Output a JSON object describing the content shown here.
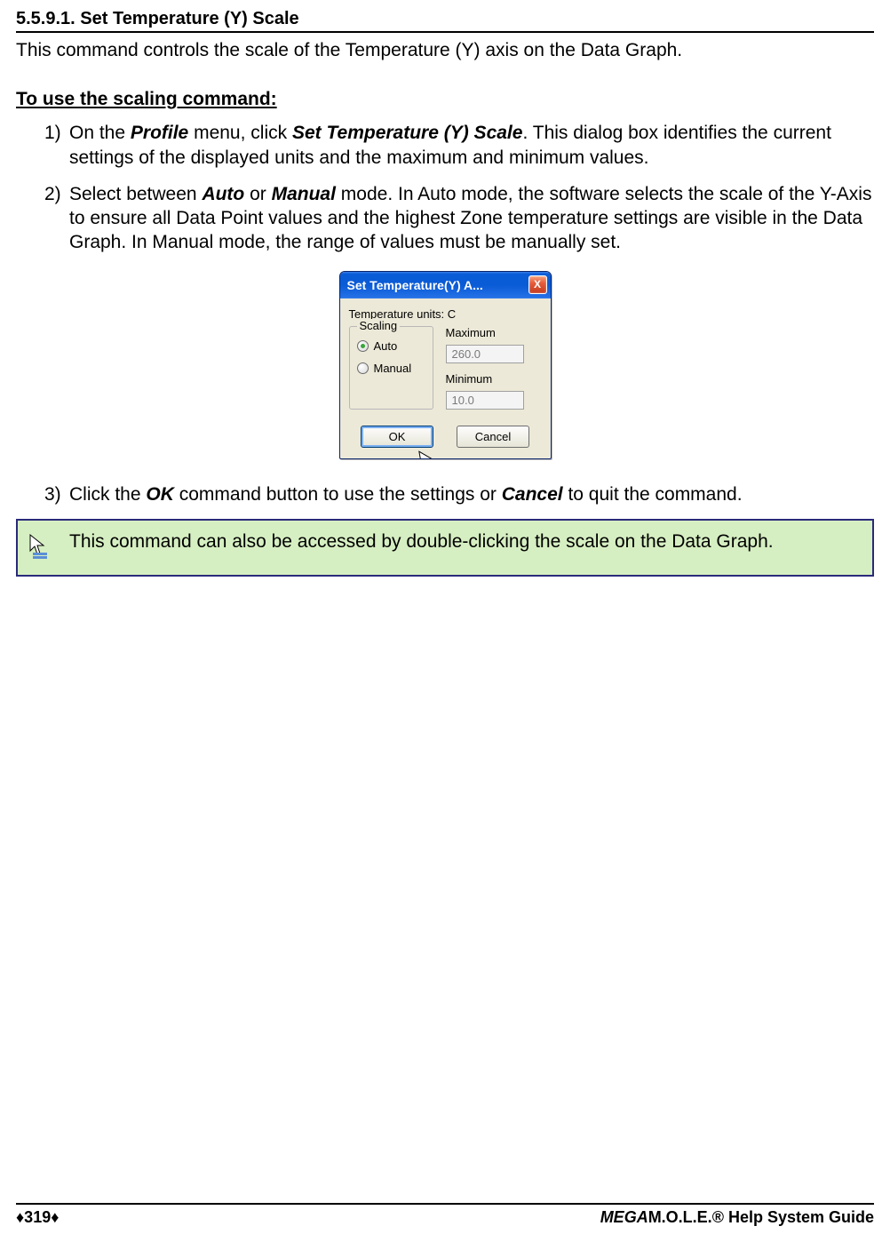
{
  "header": "5.5.9.1. Set Temperature (Y) Scale",
  "intro": "This command controls the scale of the Temperature (Y) axis on the Data Graph.",
  "subheader": "To use the scaling command:",
  "steps": {
    "s1a": "On the ",
    "s1b": "Profile",
    "s1c": " menu, click ",
    "s1d": "Set Temperature (Y) Scale",
    "s1e": ". This dialog box identifies the current settings of the displayed units and the maximum and minimum values.",
    "s2a": "Select between ",
    "s2b": "Auto",
    "s2c": " or ",
    "s2d": "Manual",
    "s2e": " mode. In Auto mode, the software selects the scale of the Y-Axis to ensure all Data Point values and the highest Zone temperature settings are visible in the Data Graph. In Manual mode, the range of values must be manually set.",
    "s3a": "Click the ",
    "s3b": "OK",
    "s3c": " command button to use the settings or ",
    "s3d": "Cancel",
    "s3e": " to quit the command."
  },
  "dialog": {
    "title": "Set Temperature(Y) A...",
    "close": "X",
    "units_label": "Temperature units: C",
    "scaling_label": "Scaling",
    "auto_label": "Auto",
    "manual_label": "Manual",
    "max_label": "Maximum",
    "max_value": "260.0",
    "min_label": "Minimum",
    "min_value": "10.0",
    "ok": "OK",
    "cancel": "Cancel"
  },
  "tip": "This command can also be accessed by double-clicking the scale on the Data Graph.",
  "footer": {
    "page": "♦319♦",
    "guide_italic": "MEGA",
    "guide_rest": "M.O.L.E.® Help System Guide"
  }
}
